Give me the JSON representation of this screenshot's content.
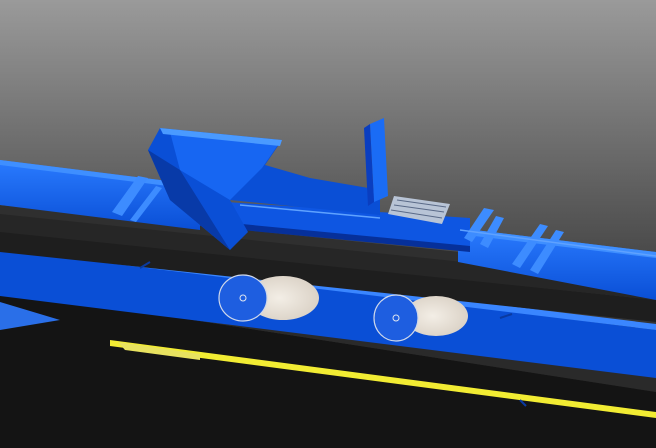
{
  "viewport": {
    "kind": "3d-cad-model-view",
    "subject": "belt-conveyor-transfer-chute"
  },
  "colors": {
    "background_top": "#9a9a9a",
    "background_bottom": "#0d0d0d",
    "steel_blue": "#0a4fd6",
    "steel_blue_light": "#2a7bff",
    "steel_blue_dark": "#06309a",
    "belt_dark": "#1e1e1e",
    "belt_mid": "#2f2f2f",
    "idler_face": "#d9d0c4",
    "accent_yellow": "#f2ec33",
    "grate": "#b8c4d6"
  },
  "icons": {
    "chute": "transfer-chute",
    "idlers": "return-idler-roller",
    "grate": "inspection-grate"
  }
}
